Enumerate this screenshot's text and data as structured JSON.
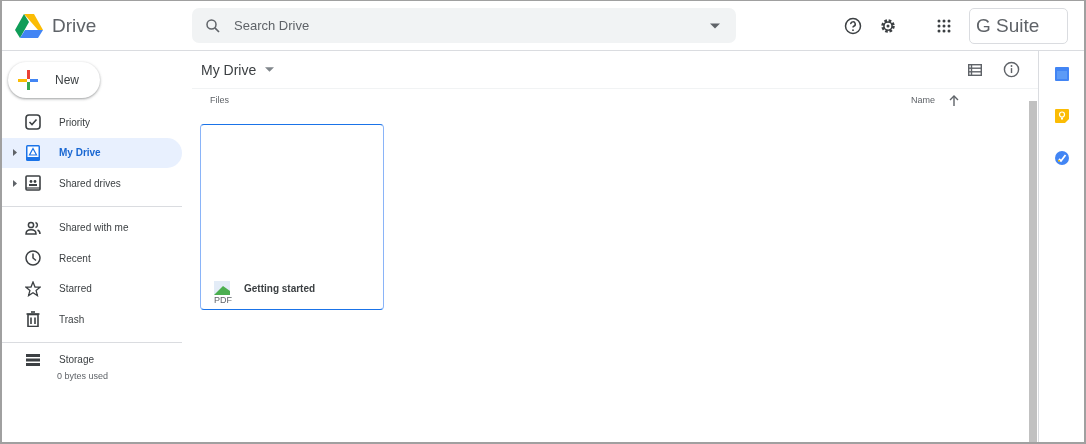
{
  "app": {
    "name": "Drive"
  },
  "search": {
    "placeholder": "Search Drive"
  },
  "brand": "G Suite",
  "new_button": "New",
  "sidebar": {
    "groups": [
      [
        {
          "label": "Priority",
          "kind": "priority",
          "selected": false,
          "expandable": false
        },
        {
          "label": "My Drive",
          "kind": "drive",
          "selected": true,
          "expandable": true
        },
        {
          "label": "Shared drives",
          "kind": "shared-drives",
          "selected": false,
          "expandable": true
        }
      ],
      [
        {
          "label": "Shared with me",
          "kind": "people",
          "selected": false,
          "expandable": false
        },
        {
          "label": "Recent",
          "kind": "clock",
          "selected": false,
          "expandable": false
        },
        {
          "label": "Starred",
          "kind": "star",
          "selected": false,
          "expandable": false
        },
        {
          "label": "Trash",
          "kind": "trash",
          "selected": false,
          "expandable": false
        }
      ]
    ]
  },
  "storage": {
    "label": "Storage",
    "usage": "0 bytes used"
  },
  "main": {
    "title": "My Drive",
    "section": "Files",
    "sort": {
      "label": "Name",
      "ascending": true
    }
  },
  "files": [
    {
      "name": "Getting started",
      "type_label": "PDF",
      "selected": true
    }
  ]
}
